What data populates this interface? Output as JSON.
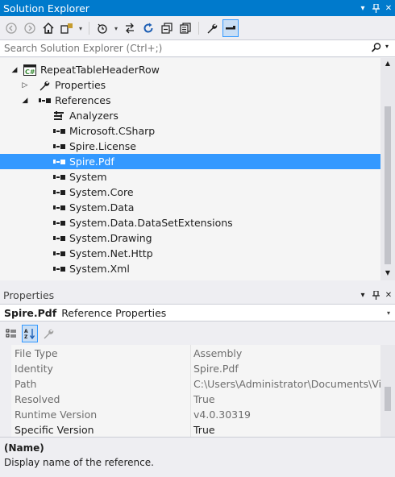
{
  "solution_explorer": {
    "title": "Solution Explorer",
    "search_placeholder": "Search Solution Explorer (Ctrl+;)",
    "tree": [
      {
        "label": "RepeatTableHeaderRow",
        "icon": "csharp-project-icon",
        "expander": "expanded"
      },
      {
        "label": "Properties",
        "icon": "wrench-icon",
        "expander": "collapsed"
      },
      {
        "label": "References",
        "icon": "references-icon",
        "expander": "expanded"
      },
      {
        "label": "Analyzers",
        "icon": "analyzers-icon",
        "expander": "none"
      },
      {
        "label": "Microsoft.CSharp",
        "icon": "reference-icon",
        "expander": "none"
      },
      {
        "label": "Spire.License",
        "icon": "reference-icon",
        "expander": "none"
      },
      {
        "label": "Spire.Pdf",
        "icon": "reference-icon",
        "expander": "none",
        "selected": true
      },
      {
        "label": "System",
        "icon": "reference-icon",
        "expander": "none"
      },
      {
        "label": "System.Core",
        "icon": "reference-icon",
        "expander": "none"
      },
      {
        "label": "System.Data",
        "icon": "reference-icon",
        "expander": "none"
      },
      {
        "label": "System.Data.DataSetExtensions",
        "icon": "reference-icon",
        "expander": "none"
      },
      {
        "label": "System.Drawing",
        "icon": "reference-icon",
        "expander": "none"
      },
      {
        "label": "System.Net.Http",
        "icon": "reference-icon",
        "expander": "none"
      },
      {
        "label": "System.Xml",
        "icon": "reference-icon",
        "expander": "none"
      }
    ]
  },
  "properties": {
    "title": "Properties",
    "object_name": "Spire.Pdf",
    "object_type": "Reference Properties",
    "rows": [
      {
        "name": "File Type",
        "value": "Assembly"
      },
      {
        "name": "Identity",
        "value": "Spire.Pdf"
      },
      {
        "name": "Path",
        "value": "C:\\Users\\Administrator\\Documents\\Visu"
      },
      {
        "name": "Resolved",
        "value": "True"
      },
      {
        "name": "Runtime Version",
        "value": "v4.0.30319"
      },
      {
        "name": "Specific Version",
        "value": "True"
      }
    ],
    "description_name": "(Name)",
    "description_text": "Display name of the reference."
  },
  "colors": {
    "accent": "#007acc",
    "selection": "#3399ff",
    "background": "#eeeef2"
  }
}
